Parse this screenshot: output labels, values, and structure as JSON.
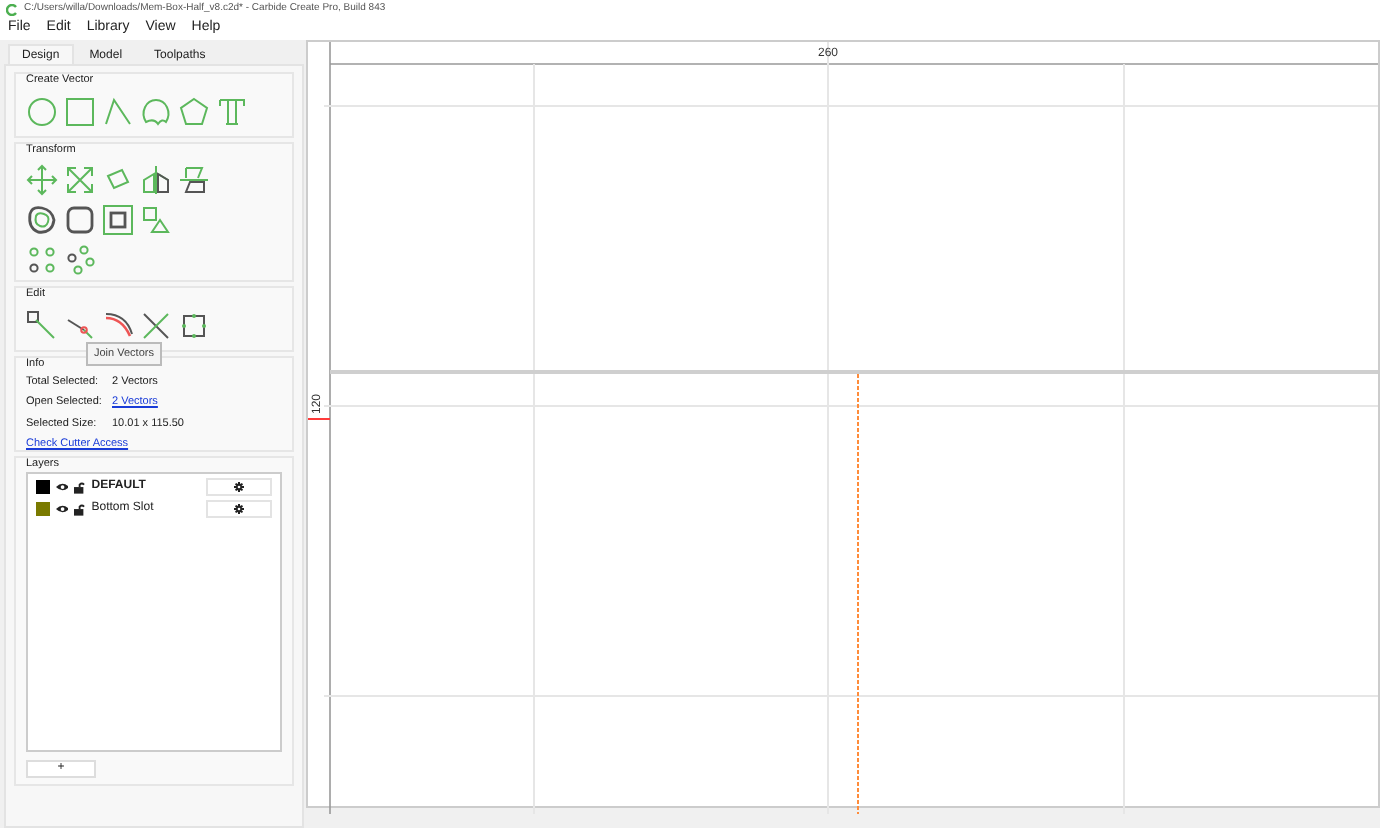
{
  "window": {
    "title": "C:/Users/willa/Downloads/Mem-Box-Half_v8.c2d* - Carbide Create Pro, Build 843"
  },
  "menu": [
    "File",
    "Edit",
    "Library",
    "View",
    "Help"
  ],
  "tabs": [
    {
      "label": "Design",
      "selected": true
    },
    {
      "label": "Model",
      "selected": false
    },
    {
      "label": "Toolpaths",
      "selected": false
    }
  ],
  "groups": {
    "create_vector": "Create Vector",
    "transform": "Transform",
    "edit": "Edit",
    "info": "Info",
    "layers": "Layers"
  },
  "tooltip": "Join Vectors",
  "info": [
    {
      "label": "Total Selected:",
      "value": "2 Vectors",
      "kind": "text"
    },
    {
      "label": "Open Selected:",
      "value": "2 Vectors",
      "kind": "link"
    },
    {
      "label": "Selected Size:",
      "value": "10.01 x 115.50",
      "kind": "text"
    }
  ],
  "info_link": "Check Cutter Access",
  "layers": [
    {
      "name": "DEFAULT",
      "color": "#000000",
      "active": true
    },
    {
      "name": "Bottom Slot",
      "color": "#7a7a00",
      "active": false
    }
  ],
  "add_layer_button": "+",
  "rulers": {
    "top_label": "260",
    "left_label": "120"
  }
}
